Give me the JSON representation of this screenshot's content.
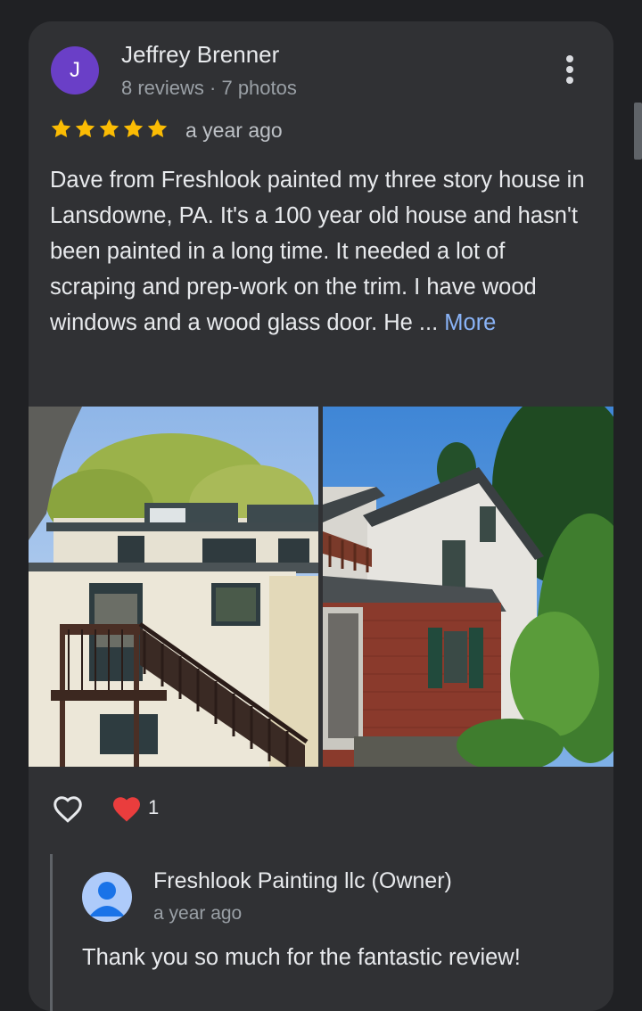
{
  "reviewer": {
    "initial": "J",
    "name": "Jeffrey Brenner",
    "meta": "8 reviews · 7 photos",
    "avatar_color": "#6a3fc7"
  },
  "rating": {
    "stars": 5,
    "max": 5,
    "time": "a year ago",
    "star_color": "#fbbc04"
  },
  "review": {
    "text": "Dave from Freshlook painted my three story house in Lansdowne, PA. It's a 100 year old house and hasn't been painted in a long time. It needed a lot of scraping and prep-work on the trim. I have wood windows and a wood glass door. He ...",
    "more_label": "More"
  },
  "photos": [
    {
      "icon": "house-back-stairs-photo"
    },
    {
      "icon": "house-brick-side-photo"
    }
  ],
  "reactions": {
    "like_icon": "heart-outline-icon",
    "reaction_icon": "red-heart-icon",
    "count": "1"
  },
  "owner_reply": {
    "name": "Freshlook Painting llc (Owner)",
    "time": "a year ago",
    "text": "Thank you so much for the fantastic review!"
  }
}
